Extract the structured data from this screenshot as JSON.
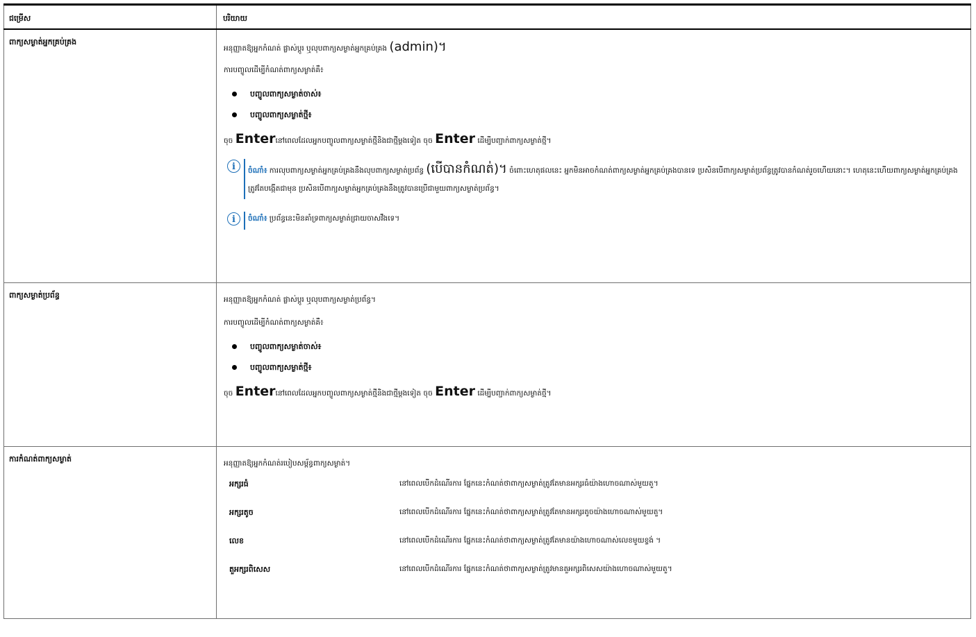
{
  "header": {
    "col1": "ជម្រើស",
    "col2": "បរិយាយ"
  },
  "rows": {
    "admin": {
      "name": "ពាក្យសម្ងាត់អ្នកគ្រប់គ្រង",
      "desc_a": "អនុញ្ញាតឱ្យអ្នកកំណត់ ផ្លាស់ប្ដូរ ឬលុបពាក្យសម្ងាត់អ្នកគ្រប់គ្រង",
      "desc_b": "(admin)។",
      "entry_intro": "ការបញ្ចូលដើម្បីកំណត់ពាក្យសម្ងាត់គឺ៖",
      "bullet1": "បញ្ចូលពាក្យសម្ងាត់ចាស់៖",
      "bullet2": "បញ្ចូលពាក្យសម្ងាត់ថ្មី៖",
      "press1": "ចុច",
      "enter1": "Enter",
      "mid": "នៅពេលដែលអ្នកបញ្ចូលពាក្យសម្ងាត់ថ្មីនិងជាថ្មីម្ដងទៀត ចុច",
      "enter2": "Enter",
      "end": "ដើម្បីបញ្ជាក់ពាក្យសម្ងាត់ថ្មី។",
      "note1_label": "ចំណាំ៖",
      "note1_a": "ការលុបពាក្យសម្ងាត់អ្នកគ្រប់គ្រងនឹងលុបពាក្យសម្ងាត់ប្រព័ន្ធ",
      "note1_b": "(បើបានកំណត់)។",
      "note1_c": "ចំពោះហេតុផលនេះ អ្នកមិនអាចកំណត់ពាក្យសម្ងាត់អ្នកគ្រប់គ្រងបានទេ ប្រសិនបើពាក្យសម្ងាត់ប្រព័ន្ធត្រូវបានកំណត់រួចហើយនោះ។",
      "note1_d": "ហេតុនេះហើយពាក្យសម្ងាត់អ្នកគ្រប់គ្រង ត្រូវតែបង្កើតជាមុន ប្រសិនបើពាក្យសម្ងាត់អ្នកគ្រប់គ្រងនឹងត្រូវបានប្រើជាមួយពាក្យសម្ងាត់ប្រព័ន្ធ។",
      "note2_label": "ចំណាំ៖",
      "note2": "ប្រព័ន្ធនេះមិនគាំទ្រពាក្យសម្ងាត់ជ្រាយចាសវឹងទេ។"
    },
    "system": {
      "name": "ពាក្យសម្ងាត់ប្រព័ន្ធ",
      "desc": "អនុញ្ញាតឱ្យអ្នកកំណត់ ផ្លាស់ប្ដូរ ឬលុបពាក្យសម្ងាត់ប្រព័ន្ធ។",
      "entry_intro": "ការបញ្ចូលដើម្បីកំណត់ពាក្យសម្ងាត់គឺ៖",
      "bullet1": "បញ្ចូលពាក្យសម្ងាត់ចាស់៖",
      "bullet2": "បញ្ចូលពាក្យសម្ងាត់ថ្មី៖",
      "press1": "ចុច",
      "enter1": "Enter",
      "mid": "នៅពេលដែលអ្នកបញ្ចូលពាក្យសម្ងាត់ថ្មីនិងជាថ្មីម្ដងទៀត ចុច",
      "enter2": "Enter",
      "end": "ដើម្បីបញ្ជាក់ពាក្យសម្ងាត់ថ្មី។"
    },
    "config": {
      "name": "ការកំណត់ពាក្យសម្ងាត់",
      "desc": "អនុញ្ញាតឱ្យអ្នកកំណត់របៀបសម្ព័ន្ធពាក្យសម្ងាត់។",
      "items": [
        {
          "k": "អក្សរធំ",
          "v": "នៅពេលបើកដំណើរការ ផ្នែកនេះកំណត់ថាពាក្យសម្ងាត់ត្រូវតែមានអក្សរធំយ៉ាងហោចណាស់មួយតួ។"
        },
        {
          "k": "អក្សរតូច",
          "v": "នៅពេលបើកដំណើរការ ផ្នែកនេះកំណត់ថាពាក្យសម្ងាត់ត្រូវតែមានអក្សរតូចយ៉ាងហោចណាស់មួយតួ។"
        },
        {
          "k": "លេខ",
          "v": "នៅពេលបើកដំណើរការ ផ្នែកនេះកំណត់ថាពាក្យសម្ងាត់ត្រូវតែមានយ៉ាងហោចណាស់លេខមួយខ្ទង់ ។"
        },
        {
          "k": "តួអក្សរពិសេស",
          "v": "នៅពេលបើកដំណើរការ ផ្នែកនេះកំណត់ថាពាក្យសម្ងាត់ត្រូវមានតួអក្សរពិសេសយ៉ាងហោចណាស់មួយតួ។"
        }
      ]
    }
  },
  "colors": {
    "note_blue": "#1c6fb8"
  },
  "icons": {
    "note": "info-circle-icon",
    "bullet": "bullet-dot-icon"
  }
}
